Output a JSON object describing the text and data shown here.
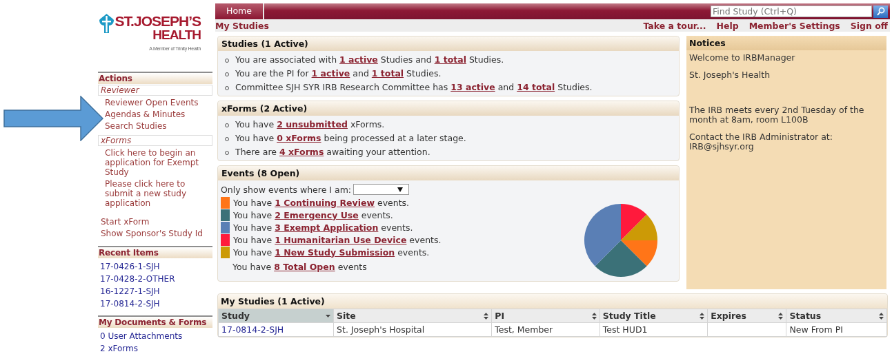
{
  "logo": {
    "lines": [
      "ST.JOSEPH’S",
      "HEALTH"
    ],
    "tagline": "A Member of Trinity Health"
  },
  "sidebar": {
    "sections": [
      {
        "title": "Actions",
        "kind": "actions",
        "groups": [
          {
            "title": "Reviewer",
            "items": [
              "Reviewer Open Events",
              "Agendas & Minutes",
              "Search Studies"
            ]
          },
          {
            "title": "xForms",
            "items": [
              "Click here to begin an application for Exempt Study",
              "Please click here to submit a new study application"
            ]
          }
        ],
        "items": [
          "Start xForm",
          "Show Sponsor's Study Id"
        ]
      },
      {
        "title": "Recent Items",
        "kind": "records",
        "items": [
          "17-0426-1-SJH",
          "17-0428-2-OTHER",
          "16-1227-1-SJH",
          "17-0814-2-SJH"
        ]
      },
      {
        "title": "My Documents & Forms",
        "kind": "records",
        "items": [
          "0 User Attachments",
          "2 xForms"
        ]
      }
    ]
  },
  "topbar": {
    "tabs": [
      {
        "label": "Home",
        "selected": true
      }
    ],
    "search": {
      "placeholder": "Find Study (Ctrl+Q)"
    }
  },
  "subbar": {
    "title": "My Studies",
    "links": [
      "Take a tour...",
      "Help",
      "Member's Settings",
      "Sign off"
    ]
  },
  "studies": {
    "title": "Studies (1 Active)",
    "bullets": [
      [
        {
          "kind": "text",
          "text": "You are associated with "
        },
        {
          "kind": "link",
          "text": "1 active"
        },
        {
          "kind": "text",
          "text": " Studies and "
        },
        {
          "kind": "link",
          "text": "1 total"
        },
        {
          "kind": "text",
          "text": " Studies."
        }
      ],
      [
        {
          "kind": "text",
          "text": "You are the PI for "
        },
        {
          "kind": "link",
          "text": "1 active"
        },
        {
          "kind": "text",
          "text": " and "
        },
        {
          "kind": "link",
          "text": "1 total"
        },
        {
          "kind": "text",
          "text": " Studies."
        }
      ],
      [
        {
          "kind": "text",
          "text": "Committee SJH SYR IRB Research Committee has "
        },
        {
          "kind": "link",
          "text": "13 active"
        },
        {
          "kind": "text",
          "text": " and "
        },
        {
          "kind": "link",
          "text": "14 total"
        },
        {
          "kind": "text",
          "text": " Studies."
        }
      ]
    ]
  },
  "xforms": {
    "title": "xForms (2 Active)",
    "bullets": [
      [
        {
          "kind": "text",
          "text": "You have "
        },
        {
          "kind": "link",
          "text": "2 unsubmitted"
        },
        {
          "kind": "text",
          "text": " xForms."
        }
      ],
      [
        {
          "kind": "text",
          "text": "You have "
        },
        {
          "kind": "link",
          "text": "0 xForms"
        },
        {
          "kind": "text",
          "text": " being processed at a later stage."
        }
      ],
      [
        {
          "kind": "text",
          "text": "There are "
        },
        {
          "kind": "link",
          "text": "4 xForms"
        },
        {
          "kind": "text",
          "text": " awaiting your attention."
        }
      ]
    ]
  },
  "events": {
    "title": "Events (8 Open)",
    "filter_label": "Only show events where I am:",
    "items": [
      {
        "color": "#ff7518",
        "parts": [
          {
            "kind": "text",
            "text": "You have "
          },
          {
            "kind": "link",
            "text": "1 Continuing Review"
          },
          {
            "kind": "text",
            "text": " events."
          }
        ]
      },
      {
        "color": "#3b7178",
        "parts": [
          {
            "kind": "text",
            "text": "You have "
          },
          {
            "kind": "link",
            "text": "2 Emergency Use"
          },
          {
            "kind": "text",
            "text": " events."
          }
        ]
      },
      {
        "color": "#5a7fb5",
        "parts": [
          {
            "kind": "text",
            "text": "You have "
          },
          {
            "kind": "link",
            "text": "3 Exempt Application"
          },
          {
            "kind": "text",
            "text": " events."
          }
        ]
      },
      {
        "color": "#ff1a3c",
        "parts": [
          {
            "kind": "text",
            "text": "You have "
          },
          {
            "kind": "link",
            "text": "1 Humanitarian Use Device"
          },
          {
            "kind": "text",
            "text": " events."
          }
        ]
      },
      {
        "color": "#cc9a06",
        "parts": [
          {
            "kind": "text",
            "text": "You have "
          },
          {
            "kind": "link",
            "text": "1 New Study Submission"
          },
          {
            "kind": "text",
            "text": " events."
          }
        ]
      }
    ],
    "total": [
      {
        "kind": "text",
        "text": "You have "
      },
      {
        "kind": "link",
        "text": "8 Total Open"
      },
      {
        "kind": "text",
        "text": " events"
      }
    ],
    "chart_data": {
      "type": "pie",
      "series": [
        {
          "values": [
            12.5,
            12.5,
            12.5,
            25,
            37.5
          ]
        }
      ],
      "colors": [
        "#ff1a3c",
        "#cc9a06",
        "#ff7518",
        "#3b7178",
        "#5a7fb5"
      ]
    }
  },
  "notices": {
    "title": "Notices",
    "paragraphs": [
      "Welcome to IRBManager",
      "St. Joseph's Health",
      "The IRB meets every 2nd Tuesday of the month at 8am, room L100B",
      "Contact the IRB Administrator at: IRB@sjhsyr.org"
    ]
  },
  "my_studies": {
    "title": "My Studies (1 Active)",
    "columns": [
      {
        "label": "Study",
        "sorted": true
      },
      {
        "label": "Site",
        "sorted": false
      },
      {
        "label": "PI",
        "sorted": false
      },
      {
        "label": "Study Title",
        "sorted": false
      },
      {
        "label": "Expires",
        "sorted": false
      },
      {
        "label": "Status",
        "sorted": false
      }
    ],
    "rows": [
      [
        "17-0814-2-SJH",
        "St. Joseph's Hospital",
        "Test, Member",
        "Test HUD1",
        null,
        "New From PI"
      ]
    ]
  }
}
